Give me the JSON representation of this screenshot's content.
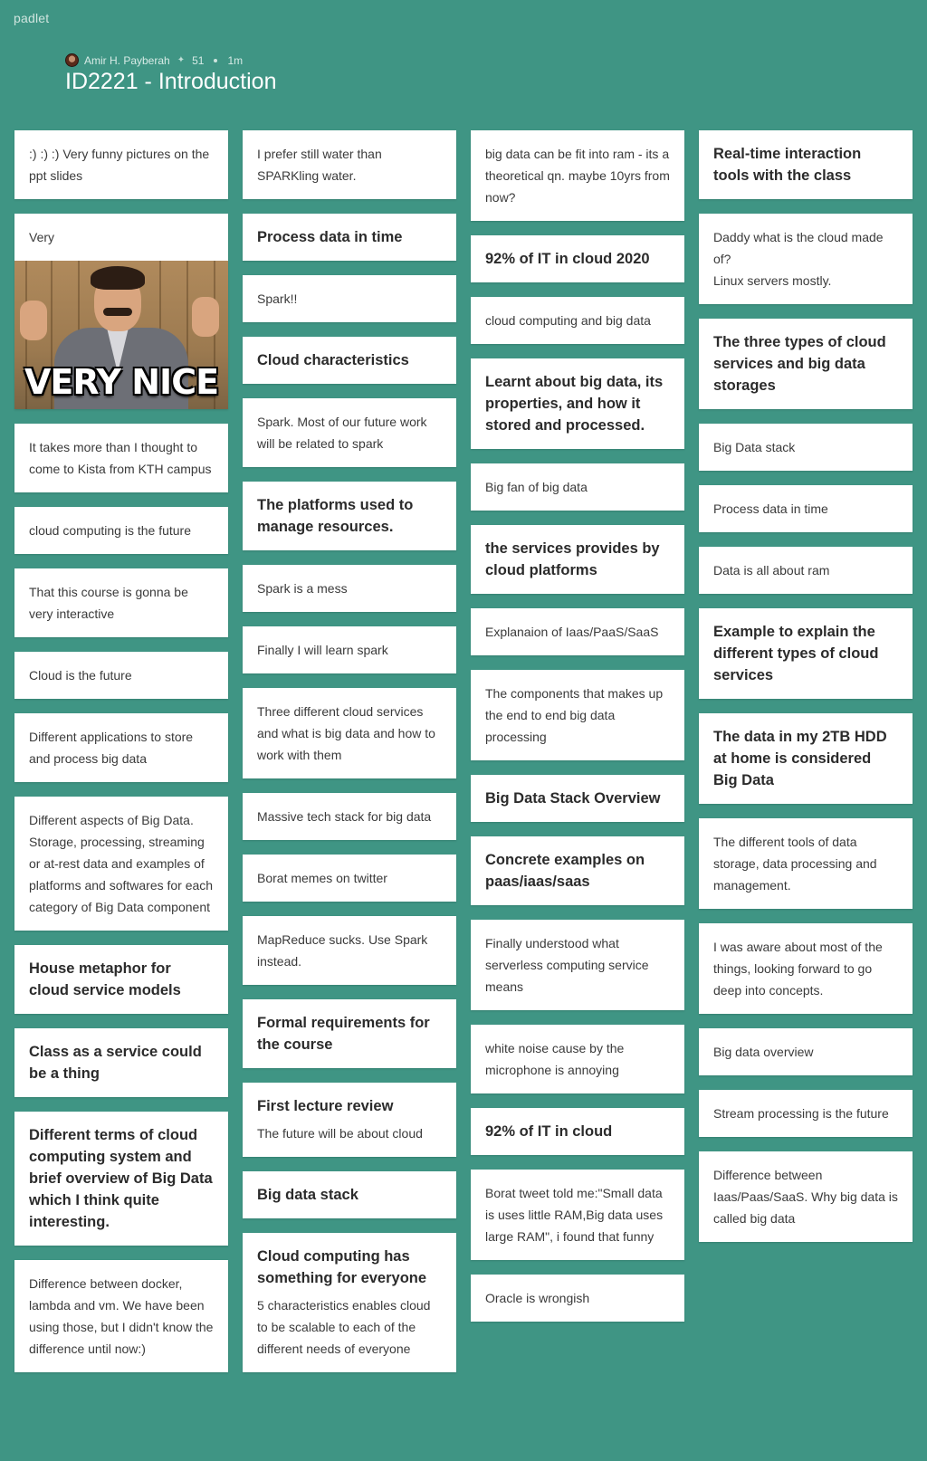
{
  "brand": "padlet",
  "header": {
    "author": "Amir H. Payberah",
    "count_icon": "✦",
    "count": "51",
    "time": "1m",
    "title": "ID2221 - Introduction"
  },
  "columns": [
    [
      {
        "body": ":) :) :) Very funny pictures on the ppt slides"
      },
      {
        "body": "Very",
        "image_caption": "VERY NICE"
      },
      {
        "body": "It takes more than I thought to come to Kista from KTH campus"
      },
      {
        "body": "cloud computing is the future"
      },
      {
        "body": "That this course is gonna be very interactive"
      },
      {
        "body": "Cloud is the future"
      },
      {
        "body": "Different applications to store and process big data"
      },
      {
        "body": "Different aspects of Big Data. Storage, processing, streaming or at-rest data and examples of platforms and softwares for each category of Big Data component"
      },
      {
        "title": "House metaphor for cloud service models"
      },
      {
        "title": "Class as a service could be a thing"
      },
      {
        "title": "Different terms of cloud computing system and brief overview of Big Data which I think quite interesting."
      },
      {
        "body": "Difference between docker, lambda and vm. We have been using those, but I didn't know the difference until now:)"
      }
    ],
    [
      {
        "body": "I prefer still water than SPARKling water."
      },
      {
        "title": "Process data in time"
      },
      {
        "body": "Spark!!"
      },
      {
        "title": "Cloud characteristics"
      },
      {
        "body": "Spark. Most of our future work will be related to spark"
      },
      {
        "title": "The platforms used to manage resources."
      },
      {
        "body": "Spark is a mess"
      },
      {
        "body": "Finally I will learn spark"
      },
      {
        "body": "Three different cloud services and what is big data and how to work with them"
      },
      {
        "body": "Massive tech stack for big data"
      },
      {
        "body": "Borat memes on twitter"
      },
      {
        "body": "MapReduce sucks. Use Spark instead."
      },
      {
        "title": "Formal requirements for the course"
      },
      {
        "title": "First lecture review",
        "body": "The future will be about cloud"
      },
      {
        "title": "Big data stack"
      },
      {
        "title": "Cloud computing has something for everyone",
        "body": "5 characteristics enables cloud to be scalable to each of the different needs of everyone"
      }
    ],
    [
      {
        "body": "big data can be fit into ram - its a theoretical qn. maybe 10yrs from now?"
      },
      {
        "title": "92% of IT in cloud 2020"
      },
      {
        "body": "cloud computing and big data"
      },
      {
        "title": "Learnt about big data, its properties, and how it stored and processed."
      },
      {
        "body": "Big fan of big data"
      },
      {
        "title": "the services provides by cloud platforms"
      },
      {
        "body": "Explanaion of Iaas/PaaS/SaaS"
      },
      {
        "body": "The components that makes up the end to end big data processing"
      },
      {
        "title": "Big Data Stack Overview"
      },
      {
        "title": "Concrete examples on paas/iaas/saas"
      },
      {
        "body": "Finally understood what serverless computing service means"
      },
      {
        "body": "white noise cause by the microphone is annoying"
      },
      {
        "title": "92% of IT in cloud"
      },
      {
        "body": "Borat tweet told me:\"Small data is uses little RAM,Big data uses large RAM\", i found that funny"
      },
      {
        "body": "Oracle is wrongish"
      }
    ],
    [
      {
        "title": "Real-time interaction tools with the class"
      },
      {
        "body": "Daddy what is the cloud made of?\nLinux servers mostly."
      },
      {
        "title": "The three types of cloud services and big data storages"
      },
      {
        "body": "Big Data stack"
      },
      {
        "body": "Process data in time\n "
      },
      {
        "body": "Data is all about ram"
      },
      {
        "title": "Example to explain the different types of cloud services"
      },
      {
        "title": "The data in my 2TB HDD at home is considered Big Data"
      },
      {
        "body": "The different tools of data storage, data processing and management."
      },
      {
        "body": "I was aware about most of the things, looking forward to go deep into concepts."
      },
      {
        "body": "Big data overview"
      },
      {
        "body": "Stream processing is the future"
      },
      {
        "body": "Difference between Iaas/Paas/SaaS. Why big data is called big data"
      }
    ]
  ]
}
